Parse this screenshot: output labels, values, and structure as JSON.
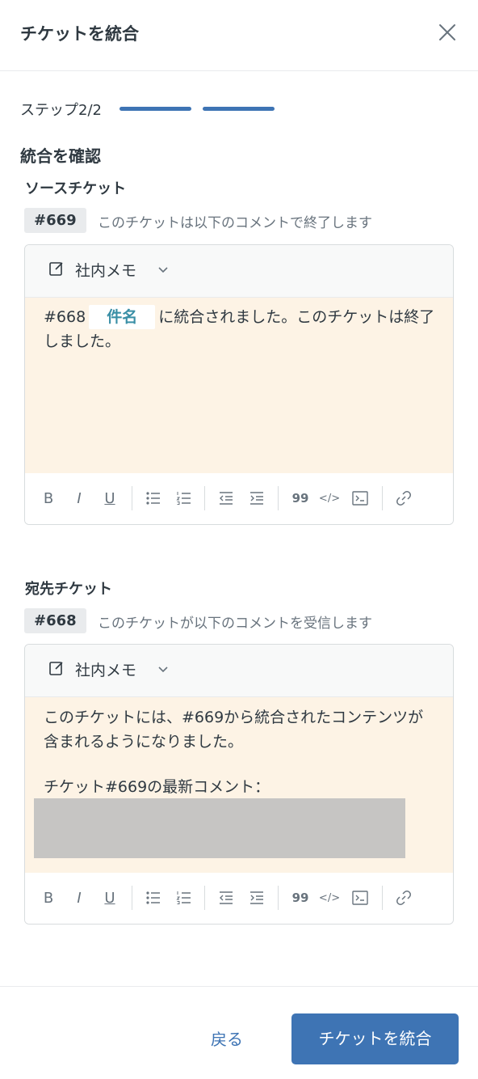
{
  "header": {
    "title": "チケットを統合"
  },
  "step": {
    "label": "ステップ2/2",
    "current": 2,
    "total": 2
  },
  "confirm_heading": "統合を確認",
  "source": {
    "heading": "ソースチケット",
    "ticket_id": "#669",
    "description": "このチケットは以下のコメントで終了します",
    "editor": {
      "mode_label": "社内メモ",
      "text_prefix": "#668",
      "subject_chip": "件名",
      "text_suffix": "に統合されました。このチケットは終了しました。"
    }
  },
  "destination": {
    "heading": "宛先チケット",
    "ticket_id": "#668",
    "description": "このチケットが以下のコメントを受信します",
    "editor": {
      "mode_label": "社内メモ",
      "line1": "このチケットには、#669から統合されたコンテンツが含まれるようになりました。",
      "line2": "チケット#669の最新コメント："
    }
  },
  "toolbar_icons": [
    "bold-icon",
    "italic-icon",
    "underline-icon",
    "bulleted-list-icon",
    "numbered-list-icon",
    "outdent-icon",
    "indent-icon",
    "quote-icon",
    "code-icon",
    "code-block-icon",
    "link-icon"
  ],
  "footer": {
    "back_label": "戻る",
    "merge_label": "チケットを統合"
  },
  "colors": {
    "primary": "#3e74b4",
    "memo_bg": "#fdf3e5",
    "chip_text": "#3a8fa6"
  }
}
